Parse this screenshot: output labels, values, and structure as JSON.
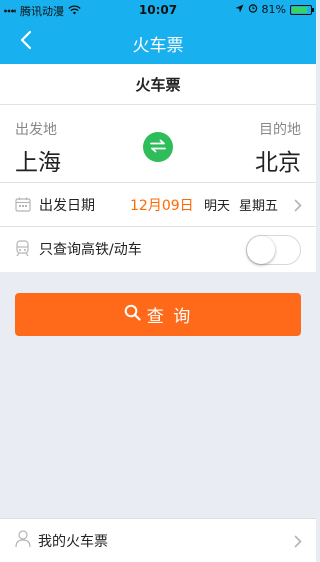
{
  "status_bar": {
    "carrier": "腾讯动漫",
    "time": "10:07",
    "battery": "81%",
    "battery_level": 0.81,
    "icons": [
      "wifi-icon",
      "location-arrow-icon",
      "alarm-icon",
      "battery-icon"
    ]
  },
  "nav": {
    "title": "火车票",
    "back_icon": "chevron-left-icon"
  },
  "sub_header": {
    "title": "火车票"
  },
  "route": {
    "from_label": "出发地",
    "from_city": "上海",
    "to_label": "目的地",
    "to_city": "北京",
    "swap_icon": "swap-arrows-icon"
  },
  "date": {
    "label": "出发日期",
    "value": "12月09日",
    "relative": "明天",
    "weekday": "星期五"
  },
  "filter": {
    "label": "只查询高铁/动车",
    "enabled": false
  },
  "search_button": {
    "label": "查 询"
  },
  "bottom": {
    "label": "我的火车票"
  },
  "colors": {
    "brand": "#18b0ee",
    "accent": "#ff6a1a",
    "date_highlight": "#ff6a00",
    "swap": "#2ebd5a",
    "background": "#e9ecf2"
  }
}
